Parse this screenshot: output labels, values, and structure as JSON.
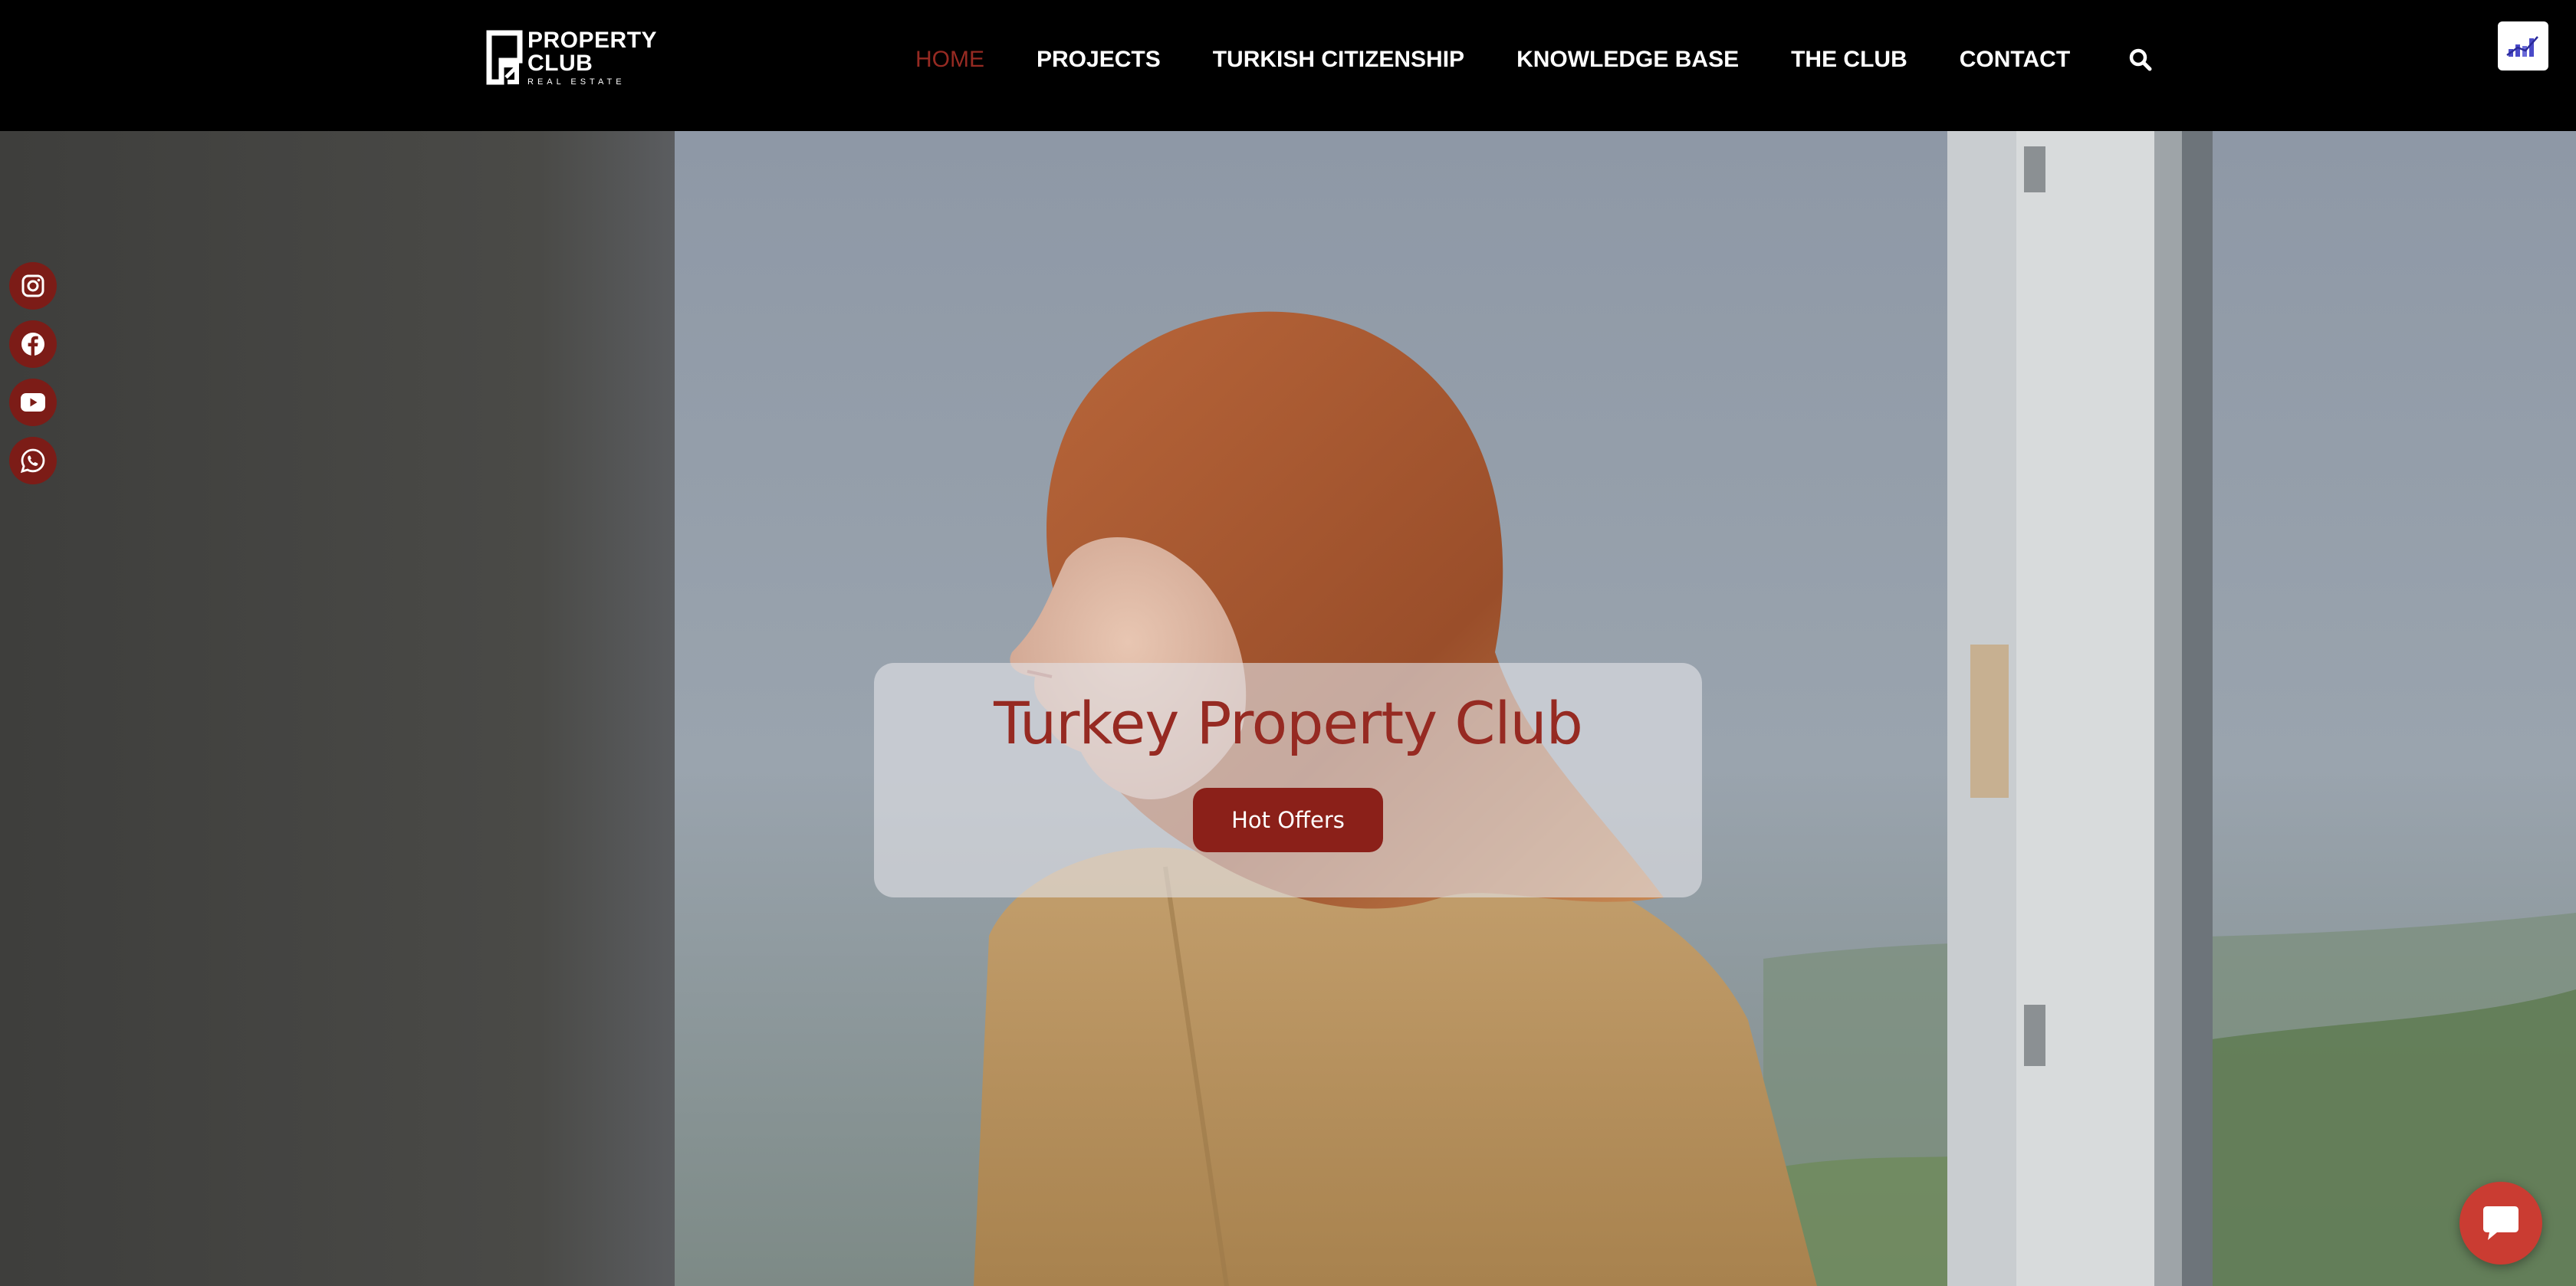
{
  "header": {
    "logo": {
      "line1": "PROPERTY",
      "line2": "CLUB",
      "line3": "REAL ESTATE"
    },
    "nav": {
      "items": [
        {
          "label": "HOME",
          "active": true
        },
        {
          "label": "PROJECTS",
          "active": false
        },
        {
          "label": "TURKISH CITIZENSHIP",
          "active": false
        },
        {
          "label": "KNOWLEDGE BASE",
          "active": false
        },
        {
          "label": "THE CLUB",
          "active": false
        },
        {
          "label": "CONTACT",
          "active": false
        }
      ],
      "search_icon": "search-icon"
    },
    "corner_widget_icon": "chart-bars-icon"
  },
  "hero": {
    "title": "Turkey Property Club",
    "button_label": "Hot Offers"
  },
  "social": [
    {
      "name": "instagram",
      "icon": "instagram-icon"
    },
    {
      "name": "facebook",
      "icon": "facebook-icon"
    },
    {
      "name": "youtube",
      "icon": "youtube-icon"
    },
    {
      "name": "whatsapp",
      "icon": "whatsapp-icon"
    }
  ],
  "chat": {
    "icon": "chat-bubble-icon"
  },
  "colors": {
    "accent": "#962a22",
    "button": "#8b2019",
    "social_bg": "#7c1c17",
    "chat_bg": "#ca3c32",
    "header_bg": "#000000",
    "widget_icon": "#4a4ac8"
  }
}
